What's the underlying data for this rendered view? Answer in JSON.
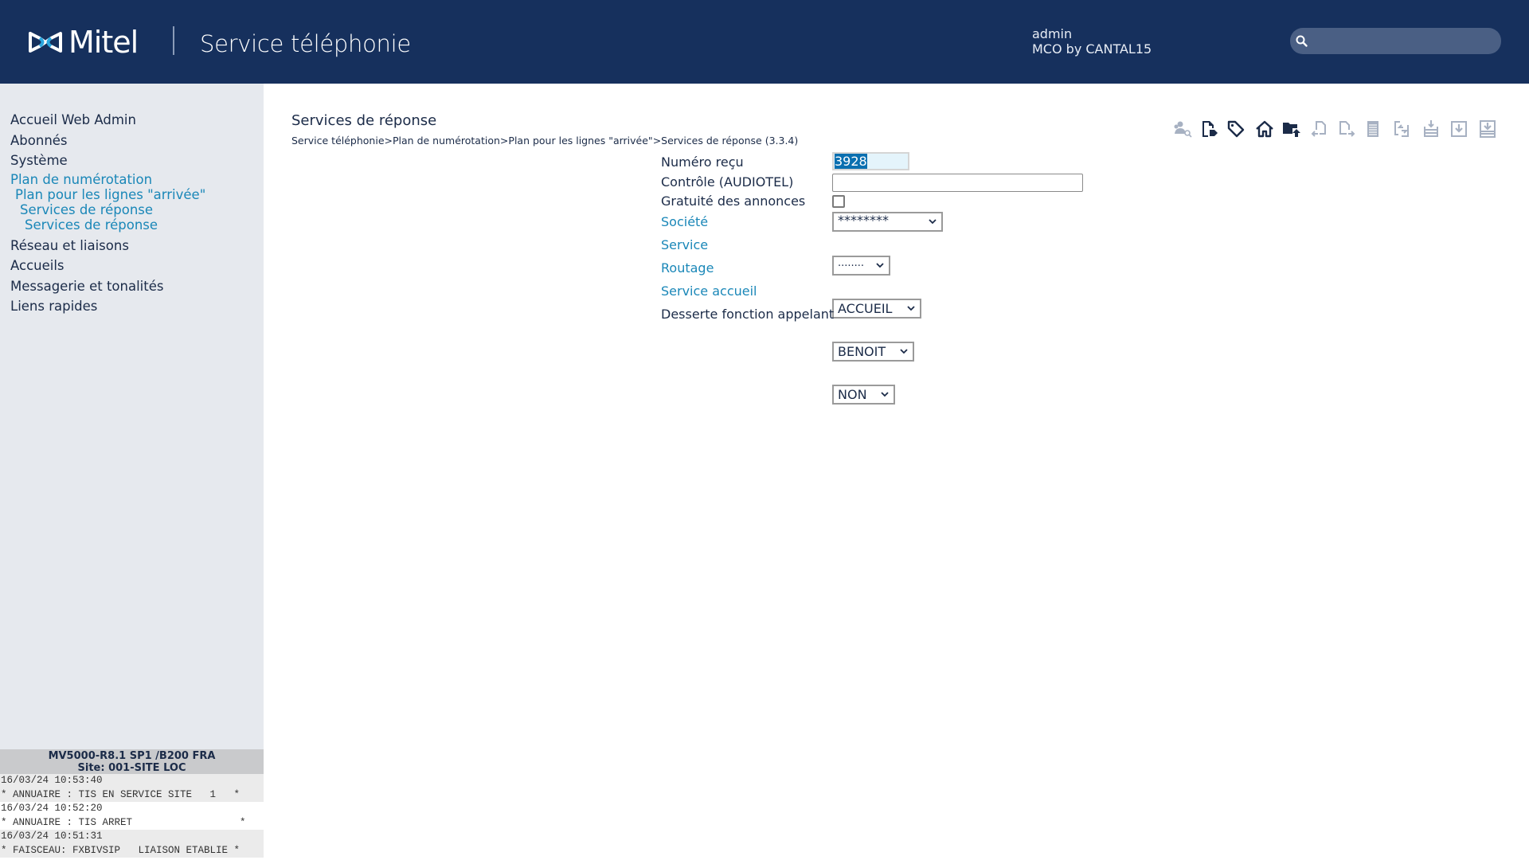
{
  "header": {
    "logo_text": "Mitel",
    "app_title": "Service téléphonie",
    "user": "admin",
    "site_user": "MCO by CANTAL15",
    "search_placeholder": "",
    "search_icon": "magnifier-icon"
  },
  "sidebar": {
    "items": [
      {
        "label": "Accueil Web Admin"
      },
      {
        "label": "Abonnés"
      },
      {
        "label": "Système"
      },
      {
        "label": "Plan de numérotation"
      },
      {
        "label": "Plan pour les lignes \"arrivée\""
      },
      {
        "label": "Services de réponse"
      },
      {
        "label": "Services de réponse"
      },
      {
        "label": "Réseau et liaisons"
      },
      {
        "label": "Accueils"
      },
      {
        "label": "Messagerie et tonalités"
      },
      {
        "label": "Liens rapides"
      }
    ],
    "status": {
      "version": "MV5000-R8.1 SP1 /B200 FRA",
      "site": "Site: 001-SITE LOC"
    },
    "log": [
      {
        "time": "16/03/24 10:53:40",
        "message": "* ANNUAIRE : TIS EN SERVICE SITE   1   *"
      },
      {
        "time": "16/03/24 10:52:20",
        "message": "* ANNUAIRE : TIS ARRET                  *"
      },
      {
        "time": "16/03/24 10:51:31",
        "message": "* FAISCEAU: FXBIVSIP   LIAISON ETABLIE *"
      }
    ]
  },
  "main": {
    "title": "Services de réponse",
    "breadcrumb": [
      "Service téléphonie",
      "Plan de numérotation",
      "Plan pour les lignes \"arrivée\"",
      "Services de réponse (3.3.4)"
    ],
    "breadcrumb_separator": ">",
    "toolbar": [
      {
        "icon": "user-search-icon",
        "enabled": false
      },
      {
        "icon": "document-edit-icon",
        "enabled": true
      },
      {
        "icon": "tag-icon",
        "enabled": true
      },
      {
        "icon": "home-icon",
        "enabled": true
      },
      {
        "icon": "folder-upload-icon",
        "enabled": true
      },
      {
        "icon": "document-back-icon",
        "enabled": false
      },
      {
        "icon": "document-forward-icon",
        "enabled": false
      },
      {
        "icon": "list-icon",
        "enabled": false
      },
      {
        "icon": "swap-icon",
        "enabled": false
      },
      {
        "icon": "database-download-icon",
        "enabled": false
      },
      {
        "icon": "download-box-icon",
        "enabled": false
      },
      {
        "icon": "download-tray-icon",
        "enabled": false
      }
    ],
    "form": {
      "numero_recu": {
        "label": "Numéro reçu",
        "value": "3928"
      },
      "controle": {
        "label": "Contrôle (AUDIOTEL)",
        "value": ""
      },
      "gratuite": {
        "label": "Gratuité des annonces",
        "checked": false
      },
      "societe": {
        "label": "Société",
        "value": "********"
      },
      "service": {
        "label": "Service",
        "value": "........"
      },
      "routage": {
        "label": "Routage",
        "value": "ACCUEIL"
      },
      "service_accueil": {
        "label": "Service accueil",
        "value": "BENOIT"
      },
      "desserte": {
        "label": "Desserte fonction appelant",
        "value": "NON"
      }
    }
  },
  "colors": {
    "header_bg": "#16305d",
    "sidebar_bg": "#e6e9ee",
    "link": "#1a87b8",
    "text": "#1b2b48",
    "icon_enabled": "#1b2b48",
    "icon_disabled": "#a7b1c2"
  }
}
